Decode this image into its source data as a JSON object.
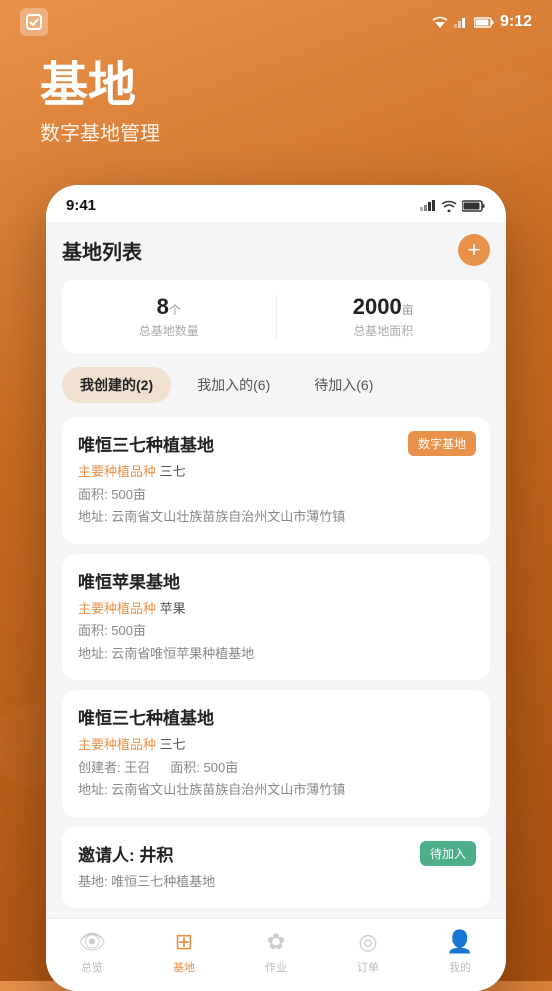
{
  "statusBar": {
    "time": "9:12",
    "appIconLabel": "app-icon"
  },
  "header": {
    "title": "基地",
    "subtitle": "数字基地管理"
  },
  "phoneStatusBar": {
    "time": "9:41"
  },
  "listHeader": {
    "title": "基地列表",
    "addLabel": "+"
  },
  "stats": [
    {
      "value": "8",
      "unit": "个",
      "label": "总基地数量"
    },
    {
      "value": "2000",
      "unit": "亩",
      "label": "总基地面积"
    }
  ],
  "tabs": [
    {
      "label": "我创建的(2)",
      "active": true
    },
    {
      "label": "我加入的(6)",
      "active": false
    },
    {
      "label": "待加入(6)",
      "active": false
    }
  ],
  "baseCards": [
    {
      "title": "唯恒三七种植基地",
      "badge": "数字基地",
      "badgeType": "digital",
      "rows": [
        {
          "label": "主要种植品种",
          "value": "三七"
        },
        {
          "label": "面积:",
          "value": "500亩"
        },
        {
          "label": "地址:",
          "value": "云南省文山壮族苗族自治州文山市薄竹镇"
        }
      ]
    },
    {
      "title": "唯恒苹果基地",
      "badge": null,
      "badgeType": null,
      "rows": [
        {
          "label": "主要种植品种",
          "value": "苹果"
        },
        {
          "label": "面积:",
          "value": "500亩"
        },
        {
          "label": "地址:",
          "value": "云南省唯恒苹果种植基地"
        }
      ]
    },
    {
      "title": "唯恒三七种植基地",
      "badge": null,
      "badgeType": null,
      "rows": [
        {
          "label": "主要种植品种",
          "value": "三七"
        },
        {
          "label": "创建者:",
          "value": "王召"
        },
        {
          "label": "面积:",
          "value": "500亩"
        },
        {
          "label": "地址:",
          "value": "云南省文山壮族苗族自治州文山市薄竹镇"
        }
      ]
    },
    {
      "title": "邀请人: 井积",
      "badge": "待加入",
      "badgeType": "join",
      "rows": [
        {
          "label": "基地:",
          "value": "唯恒三七种植基地"
        }
      ]
    }
  ],
  "bottomNav": [
    {
      "icon": "👁",
      "label": "总览",
      "active": false
    },
    {
      "icon": "⊞",
      "label": "基地",
      "active": true
    },
    {
      "icon": "✿",
      "label": "作业",
      "active": false
    },
    {
      "icon": "◎",
      "label": "订单",
      "active": false
    },
    {
      "icon": "👤",
      "label": "我的",
      "active": false
    }
  ],
  "colors": {
    "accent": "#e8914a",
    "accentLight": "#f0e0d0",
    "green": "#4caf89",
    "textPrimary": "#222222",
    "textSecondary": "#888888",
    "textOrange": "#e8914a"
  }
}
